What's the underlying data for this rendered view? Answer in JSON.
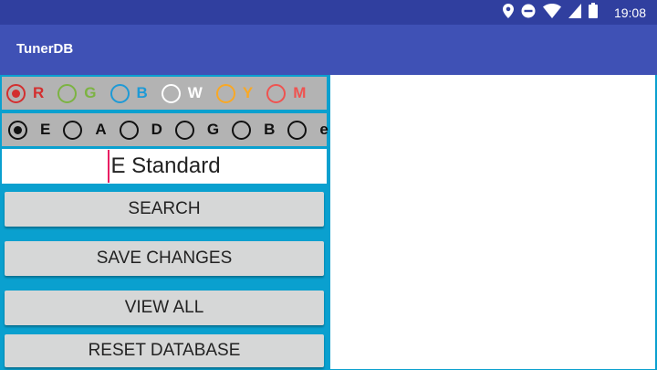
{
  "status_bar": {
    "time": "19:08"
  },
  "app_bar": {
    "title": "TunerDB"
  },
  "color_options": [
    {
      "letter": "R",
      "color": "#d32f2f",
      "checked": true
    },
    {
      "letter": "G",
      "color": "#7cb342",
      "checked": false
    },
    {
      "letter": "B",
      "color": "#1e9ad6",
      "checked": false
    },
    {
      "letter": "W",
      "color": "#ffffff",
      "checked": false
    },
    {
      "letter": "Y",
      "color": "#f9a825",
      "checked": false
    },
    {
      "letter": "M",
      "color": "#ef5350",
      "checked": false
    }
  ],
  "string_options": [
    {
      "letter": "E",
      "checked": true
    },
    {
      "letter": "A",
      "checked": false
    },
    {
      "letter": "D",
      "checked": false
    },
    {
      "letter": "G",
      "checked": false
    },
    {
      "letter": "B",
      "checked": false
    },
    {
      "letter": "e",
      "checked": false
    }
  ],
  "tuning_field": {
    "value": "E Standard"
  },
  "buttons": {
    "search": "SEARCH",
    "save_changes": "SAVE CHANGES",
    "view_all": "VIEW ALL",
    "reset_database": "RESET DATABASE"
  },
  "icons": {
    "location": "location-icon",
    "dnd": "do-not-disturb-icon",
    "wifi": "wifi-icon",
    "signal": "signal-icon",
    "battery": "battery-icon"
  }
}
